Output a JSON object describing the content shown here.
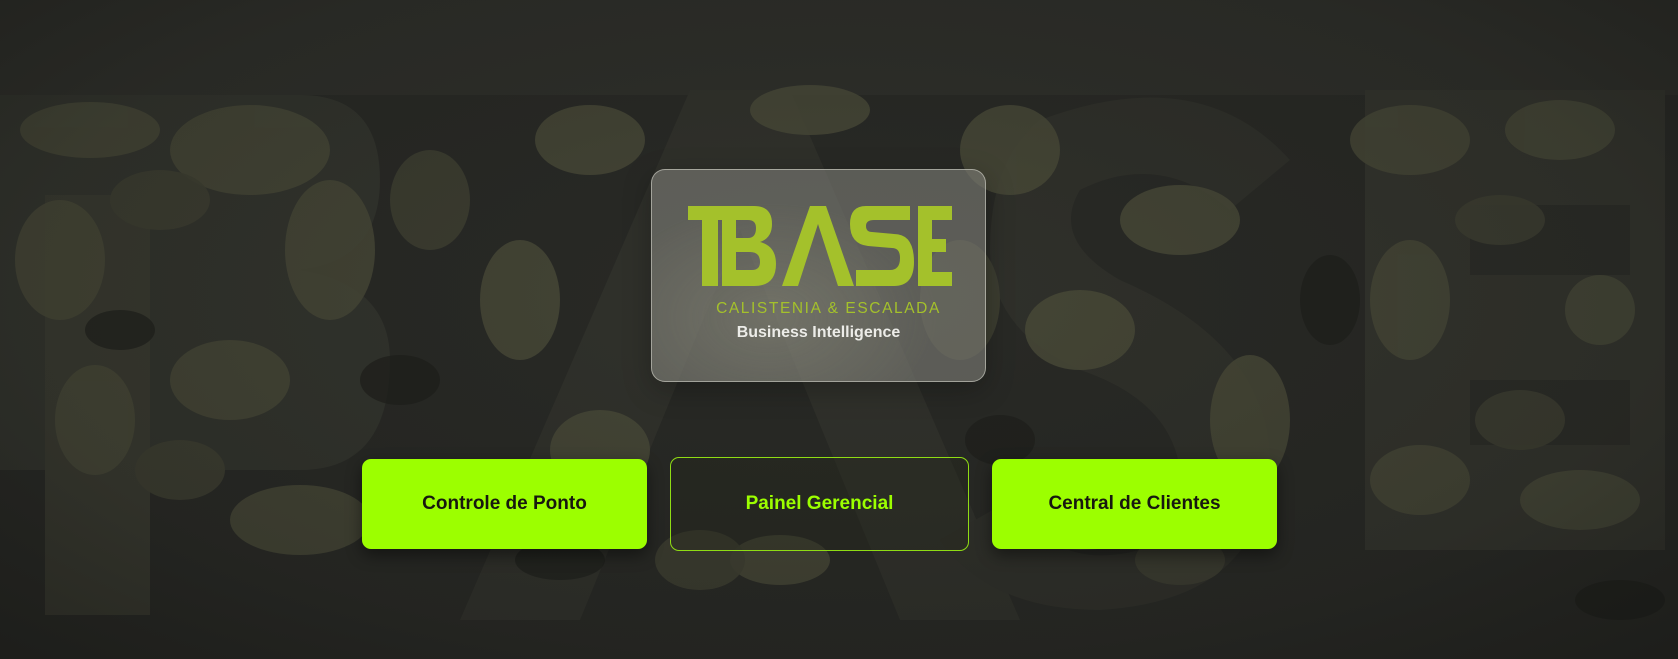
{
  "logo": {
    "wordmark": "BASE",
    "tagline": "CALISTENIA & ESCALADA",
    "subtitle": "Business Intelligence"
  },
  "buttons": {
    "controle_ponto": "Controle de Ponto",
    "painel_gerencial": "Painel Gerencial",
    "central_clientes": "Central de Clientes"
  },
  "colors": {
    "accent": "#9cff00",
    "logo_green": "#a4c12b",
    "background": "#262724",
    "camo_olive": "#4a4b39"
  }
}
